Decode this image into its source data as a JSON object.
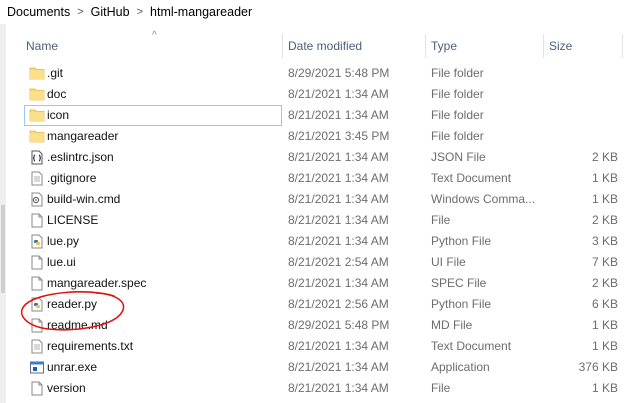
{
  "breadcrumb": {
    "items": [
      "Documents",
      "GitHub",
      "html-mangareader"
    ],
    "separator": ">"
  },
  "columns": {
    "name": "Name",
    "date": "Date modified",
    "type": "Type",
    "size": "Size"
  },
  "sort_indicator": "^",
  "files": [
    {
      "name": ".git",
      "date": "8/29/2021 5:48 PM",
      "type": "File folder",
      "size": "",
      "icon": "folder-icon"
    },
    {
      "name": "doc",
      "date": "8/21/2021 1:34 AM",
      "type": "File folder",
      "size": "",
      "icon": "folder-icon"
    },
    {
      "name": "icon",
      "date": "8/21/2021 1:34 AM",
      "type": "File folder",
      "size": "",
      "icon": "folder-icon"
    },
    {
      "name": "mangareader",
      "date": "8/21/2021 3:45 PM",
      "type": "File folder",
      "size": "",
      "icon": "folder-icon"
    },
    {
      "name": ".eslintrc.json",
      "date": "8/21/2021 1:34 AM",
      "type": "JSON File",
      "size": "2 KB",
      "icon": "json-file-icon"
    },
    {
      "name": ".gitignore",
      "date": "8/21/2021 1:34 AM",
      "type": "Text Document",
      "size": "1 KB",
      "icon": "text-file-icon"
    },
    {
      "name": "build-win.cmd",
      "date": "8/21/2021 1:34 AM",
      "type": "Windows Comma...",
      "size": "1 KB",
      "icon": "cmd-file-icon"
    },
    {
      "name": "LICENSE",
      "date": "8/21/2021 1:34 AM",
      "type": "File",
      "size": "2 KB",
      "icon": "blank-file-icon"
    },
    {
      "name": "lue.py",
      "date": "8/21/2021 1:34 AM",
      "type": "Python File",
      "size": "3 KB",
      "icon": "python-file-icon"
    },
    {
      "name": "lue.ui",
      "date": "8/21/2021 2:54 AM",
      "type": "UI File",
      "size": "7 KB",
      "icon": "blank-file-icon"
    },
    {
      "name": "mangareader.spec",
      "date": "8/21/2021 1:34 AM",
      "type": "SPEC File",
      "size": "2 KB",
      "icon": "blank-file-icon"
    },
    {
      "name": "reader.py",
      "date": "8/21/2021 2:56 AM",
      "type": "Python File",
      "size": "6 KB",
      "icon": "python-file-icon"
    },
    {
      "name": "readme.md",
      "date": "8/29/2021 5:48 PM",
      "type": "MD File",
      "size": "1 KB",
      "icon": "blank-file-icon"
    },
    {
      "name": "requirements.txt",
      "date": "8/21/2021 1:34 AM",
      "type": "Text Document",
      "size": "1 KB",
      "icon": "text-file-icon"
    },
    {
      "name": "unrar.exe",
      "date": "8/21/2021 1:34 AM",
      "type": "Application",
      "size": "376 KB",
      "icon": "exe-file-icon"
    },
    {
      "name": "version",
      "date": "8/21/2021 1:34 AM",
      "type": "File",
      "size": "1 KB",
      "icon": "blank-file-icon"
    }
  ],
  "selected_file": "icon",
  "annotation": {
    "circled_file": "reader.py",
    "color": "#e3140f"
  },
  "colors": {
    "folder": "#f8d775",
    "header_text": "#4c607a",
    "selection_border": "#99c9ef"
  }
}
